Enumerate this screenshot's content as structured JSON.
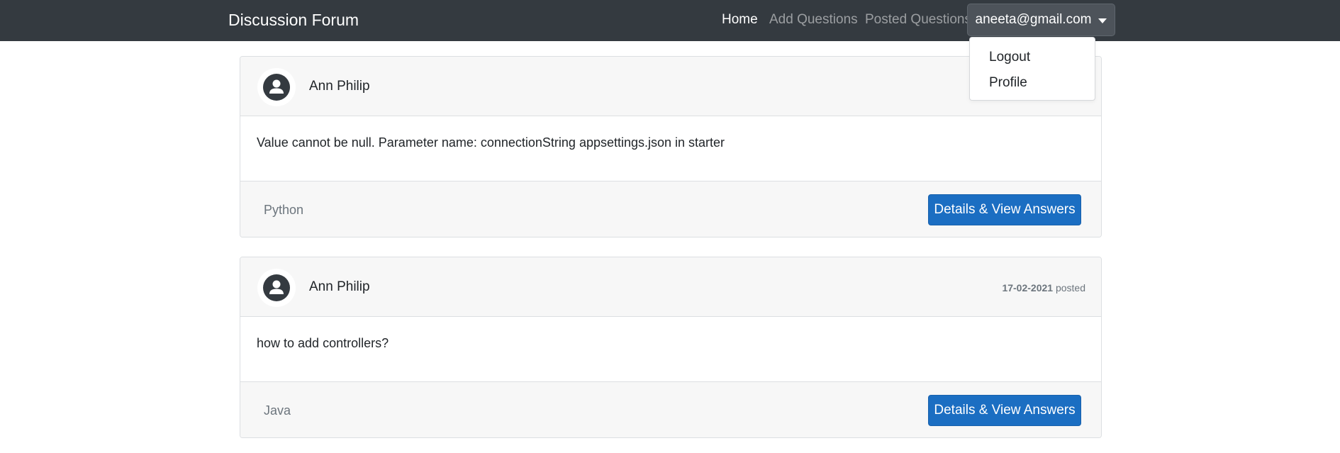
{
  "navbar": {
    "brand": "Discussion Forum",
    "links": [
      {
        "label": "Home",
        "active": true
      },
      {
        "label": "Add Questions",
        "active": false
      },
      {
        "label": "Posted Questions",
        "active": false
      }
    ],
    "user_email": "aneeta@gmail.com"
  },
  "dropdown": {
    "items": [
      {
        "label": "Logout"
      },
      {
        "label": "Profile"
      }
    ]
  },
  "posts": [
    {
      "author": "Ann Philip",
      "date": "",
      "posted_label": "",
      "question": "Value cannot be null. Parameter name: connectionString appsettings.json in starter",
      "tag": "Python",
      "button_label": "Details & View Answers"
    },
    {
      "author": "Ann Philip",
      "date": "17-02-2021",
      "posted_label": "posted",
      "question": "how to add controllers?",
      "tag": "Java",
      "button_label": "Details & View Answers"
    }
  ],
  "colors": {
    "navbar_bg": "#343a40",
    "primary_button": "#1b6ec2",
    "card_header_bg": "#f7f7f7"
  },
  "icons": {
    "avatar": "user-circle-icon",
    "dropdown_caret": "caret-down-icon"
  }
}
